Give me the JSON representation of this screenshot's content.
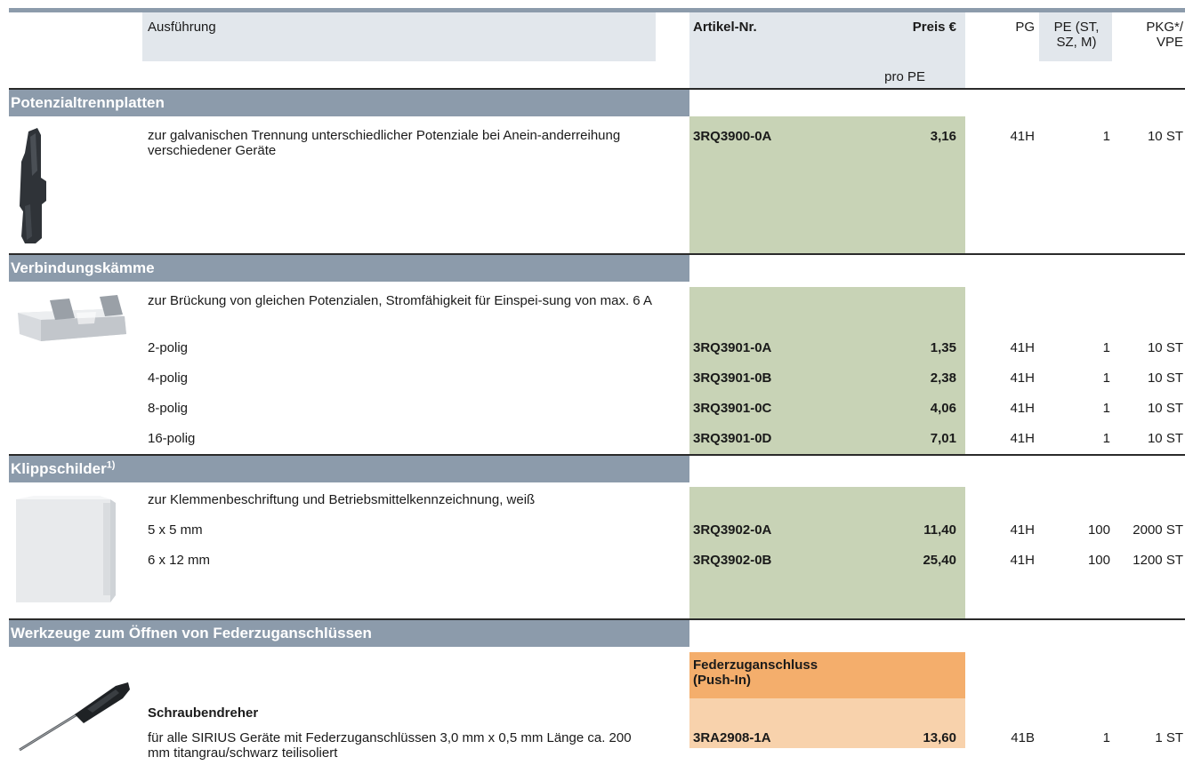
{
  "colors": {
    "section_band": "#8c9bab",
    "price_block": "#c8d3b6",
    "header_shade": "#e2e7ec",
    "push_in_header": "#f4ae6c",
    "push_in_body": "#f8d2ac"
  },
  "header": {
    "ausfuehrung": "Ausführung",
    "artikel_nr": "Artikel-Nr.",
    "preis": "Preis €",
    "pro_pe": "pro PE",
    "pg": "PG",
    "pe": "PE (ST, SZ, M)",
    "pkg": "PKG*/ VPE"
  },
  "sections": {
    "s1": {
      "title": "Potenzialtrennplatten",
      "desc": "zur galvanischen Trennung unterschiedlicher Potenziale bei Anein-anderreihung verschiedener Geräte",
      "rows": [
        {
          "art": "3RQ3900-0A",
          "price": "3,16",
          "pg": "41H",
          "pe": "1",
          "pkg": "10 ST"
        }
      ]
    },
    "s2": {
      "title": "Verbindungskämme",
      "desc": "zur Brückung von gleichen Potenzialen, Stromfähigkeit für Einspei-sung von max. 6 A",
      "rows": [
        {
          "label": "2-polig",
          "art": "3RQ3901-0A",
          "price": "1,35",
          "pg": "41H",
          "pe": "1",
          "pkg": "10 ST"
        },
        {
          "label": "4-polig",
          "art": "3RQ3901-0B",
          "price": "2,38",
          "pg": "41H",
          "pe": "1",
          "pkg": "10 ST"
        },
        {
          "label": "8-polig",
          "art": "3RQ3901-0C",
          "price": "4,06",
          "pg": "41H",
          "pe": "1",
          "pkg": "10 ST"
        },
        {
          "label": "16-polig",
          "art": "3RQ3901-0D",
          "price": "7,01",
          "pg": "41H",
          "pe": "1",
          "pkg": "10 ST"
        }
      ]
    },
    "s3": {
      "title": "Klippschilder",
      "title_sup": "1)",
      "desc": "zur Klemmenbeschriftung und Betriebsmittelkennzeichnung, weiß",
      "rows": [
        {
          "label": "5 x 5 mm",
          "art": "3RQ3902-0A",
          "price": "11,40",
          "pg": "41H",
          "pe": "100",
          "pkg": "2000 ST"
        },
        {
          "label": "6 x 12 mm",
          "art": "3RQ3902-0B",
          "price": "25,40",
          "pg": "41H",
          "pe": "100",
          "pkg": "1200 ST"
        }
      ]
    },
    "s4": {
      "title": "Werkzeuge zum Öffnen von Federzuganschlüssen",
      "push_in_header": "Federzuganschluss (Push-In)",
      "item_title": "Schraubendreher",
      "desc": "für alle SIRIUS Geräte mit Federzuganschlüssen 3,0 mm x 0,5 mm Länge ca. 200 mm titangrau/schwarz teilisoliert",
      "rows": [
        {
          "art": "3RA2908-1A",
          "price": "13,60",
          "pg": "41B",
          "pe": "1",
          "pkg": "1 ST"
        }
      ]
    }
  }
}
